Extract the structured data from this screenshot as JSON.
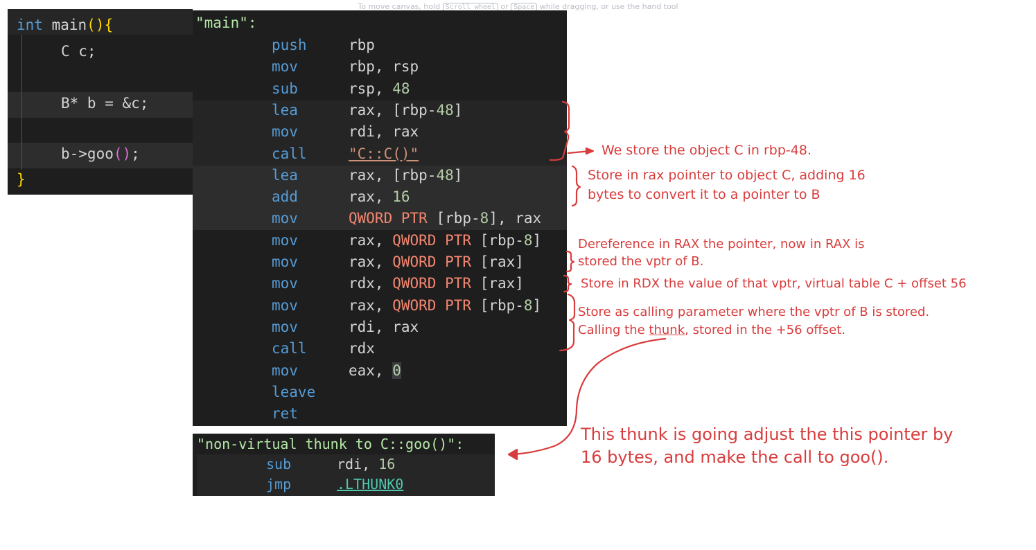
{
  "hint": {
    "before": "To move canvas, hold",
    "key1": "Scroll wheel",
    "middle": "or",
    "key2": "Space",
    "after": "while dragging, or use the hand tool"
  },
  "cpp": {
    "l1_type": "int",
    "l1_name": "main",
    "l1_parens": "()",
    "l1_brace": "{",
    "l2": "C c;",
    "l4_a": "B* b = &c;",
    "l6_a": "b->goo",
    "l6_parens": "()",
    "l6_semi": ";",
    "l7_brace": "}"
  },
  "asm_main": {
    "label": "\"main\":",
    "rows": [
      {
        "op": "push",
        "a": "rbp"
      },
      {
        "op": "mov",
        "a": "rbp, rsp"
      },
      {
        "op": "sub",
        "a": "rsp, ",
        "n": "48"
      },
      {
        "op": "lea",
        "a": "rax, [rbp-",
        "n": "48",
        "b": "]"
      },
      {
        "op": "mov",
        "a": "rdi, rax"
      },
      {
        "op": "call",
        "s": "\"C::C()\""
      },
      {
        "op": "lea",
        "a": "rax, [rbp-",
        "n": "48",
        "b": "]"
      },
      {
        "op": "add",
        "a": "rax, ",
        "n": "16"
      },
      {
        "op": "mov",
        "r": "QWORD PTR",
        "a": " [rbp-",
        "n": "8",
        "b": "], rax"
      },
      {
        "op": "mov",
        "a": "rax, ",
        "r": "QWORD PTR",
        "a2": " [rbp-",
        "n": "8",
        "b": "]"
      },
      {
        "op": "mov",
        "a": "rax, ",
        "r": "QWORD PTR",
        "a2": " [rax]"
      },
      {
        "op": "mov",
        "a": "rdx, ",
        "r": "QWORD PTR",
        "a2": " [rax]"
      },
      {
        "op": "mov",
        "a": "rax, ",
        "r": "QWORD PTR",
        "a2": " [rbp-",
        "n": "8",
        "b": "]"
      },
      {
        "op": "mov",
        "a": "rdi, rax"
      },
      {
        "op": "call",
        "a": "rdx"
      },
      {
        "op": "mov",
        "a": "eax, ",
        "z": "0"
      },
      {
        "op": "leave"
      },
      {
        "op": "ret"
      }
    ]
  },
  "asm_thunk": {
    "label": "\"non-virtual thunk to C::goo()\":",
    "row1_op": "sub",
    "row1_a": "rdi, ",
    "row1_n": "16",
    "row2_op": "jmp",
    "row2_link": ".LTHUNK0"
  },
  "notes": {
    "n1": "We store the object C in rbp-48.",
    "n2_l1": "Store in rax pointer to object C, adding 16",
    "n2_l2": "bytes to convert it to a pointer to B",
    "n3_l1": "Dereference in RAX the pointer, now in RAX is",
    "n3_l2": "stored the vptr of B.",
    "n4": "Store in RDX the value of that vptr, virtual table C + offset 56",
    "n5_l1": "Store as calling parameter where the vptr of B is stored.",
    "n5_l2a": "Calling the ",
    "n5_l2b": "thunk",
    "n5_l2c": ", stored in the +56 offset.",
    "n6_l1": "This thunk is going adjust the this pointer by",
    "n6_l2": "16 bytes, and make the call to goo()."
  },
  "colors": {
    "annotation": "#d83c3c",
    "panel_bg": "#1e1e1e",
    "keyword": "#569cd6"
  }
}
